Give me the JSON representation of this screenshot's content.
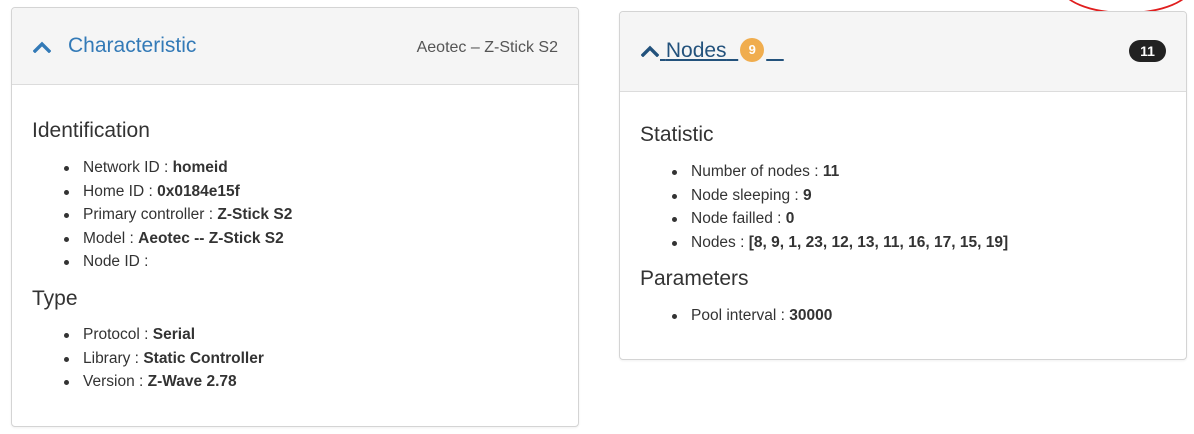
{
  "characteristic_panel": {
    "title": "Characteristic",
    "subtitle": "Aeotec – Z-Stick S2",
    "identification": {
      "heading": "Identification",
      "items": [
        {
          "label": "Network ID : ",
          "value": "homeid"
        },
        {
          "label": "Home ID : ",
          "value": "0x0184e15f"
        },
        {
          "label": "Primary controller : ",
          "value": "Z-Stick S2"
        },
        {
          "label": "Model : ",
          "value": "Aeotec -- Z-Stick S2"
        },
        {
          "label": "Node ID : ",
          "value": ""
        }
      ]
    },
    "type": {
      "heading": "Type",
      "items": [
        {
          "label": "Protocol : ",
          "value": "Serial"
        },
        {
          "label": "Library : ",
          "value": "Static Controller"
        },
        {
          "label": "Version : ",
          "value": "Z-Wave 2.78"
        }
      ]
    }
  },
  "nodes_panel": {
    "title": "Nodes",
    "sleeping_badge": "9",
    "total_badge": "11",
    "statistic": {
      "heading": "Statistic",
      "items": [
        {
          "label": "Number of nodes : ",
          "value": "11"
        },
        {
          "label": "Node sleeping : ",
          "value": "9"
        },
        {
          "label": "Node failled : ",
          "value": "0"
        },
        {
          "label": "Nodes : ",
          "value": "[8, 9, 1, 23, 12, 13, 11, 16, 17, 15, 19]"
        }
      ]
    },
    "parameters": {
      "heading": "Parameters",
      "items": [
        {
          "label": "Pool interval : ",
          "value": "30000"
        }
      ]
    }
  },
  "colors": {
    "link": "#337ab7",
    "badge_orange": "#f0ad4e",
    "badge_dark": "#222222",
    "annotation_red": "#e01e1e"
  },
  "icons": [
    "chevron-up-icon"
  ]
}
